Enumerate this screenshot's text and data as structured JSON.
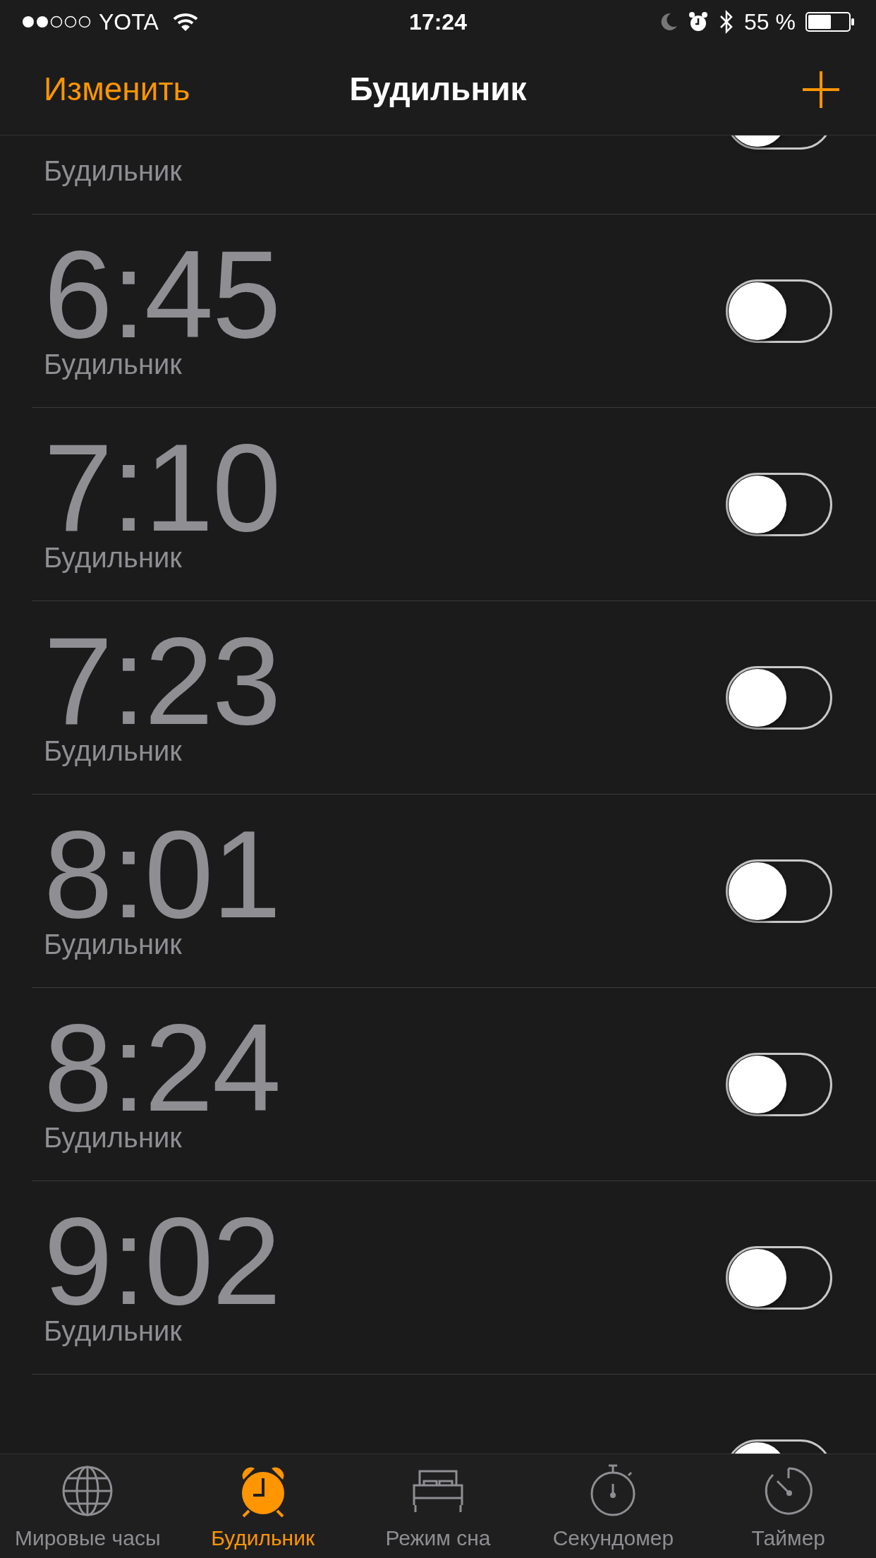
{
  "status_bar": {
    "carrier": "YOTA",
    "time": "17:24",
    "battery": "55 %"
  },
  "nav": {
    "edit": "Изменить",
    "title": "Будильник"
  },
  "alarms": [
    {
      "label": "Будильник",
      "on": false
    },
    {
      "time": "6:45",
      "label": "Будильник",
      "on": false
    },
    {
      "time": "7:10",
      "label": "Будильник",
      "on": false
    },
    {
      "time": "7:23",
      "label": "Будильник",
      "on": false
    },
    {
      "time": "8:01",
      "label": "Будильник",
      "on": false
    },
    {
      "time": "8:24",
      "label": "Будильник",
      "on": false
    },
    {
      "time": "9:02",
      "label": "Будильник",
      "on": false
    },
    {
      "on": false
    }
  ],
  "tabs": [
    {
      "kind": "globe",
      "label": "Мировые часы",
      "selected": false
    },
    {
      "kind": "alarm",
      "label": "Будильник",
      "selected": true
    },
    {
      "kind": "bed",
      "label": "Режим сна",
      "selected": false
    },
    {
      "kind": "stopwatch",
      "label": "Секундомер",
      "selected": false
    },
    {
      "kind": "timer",
      "label": "Таймер",
      "selected": false
    }
  ]
}
